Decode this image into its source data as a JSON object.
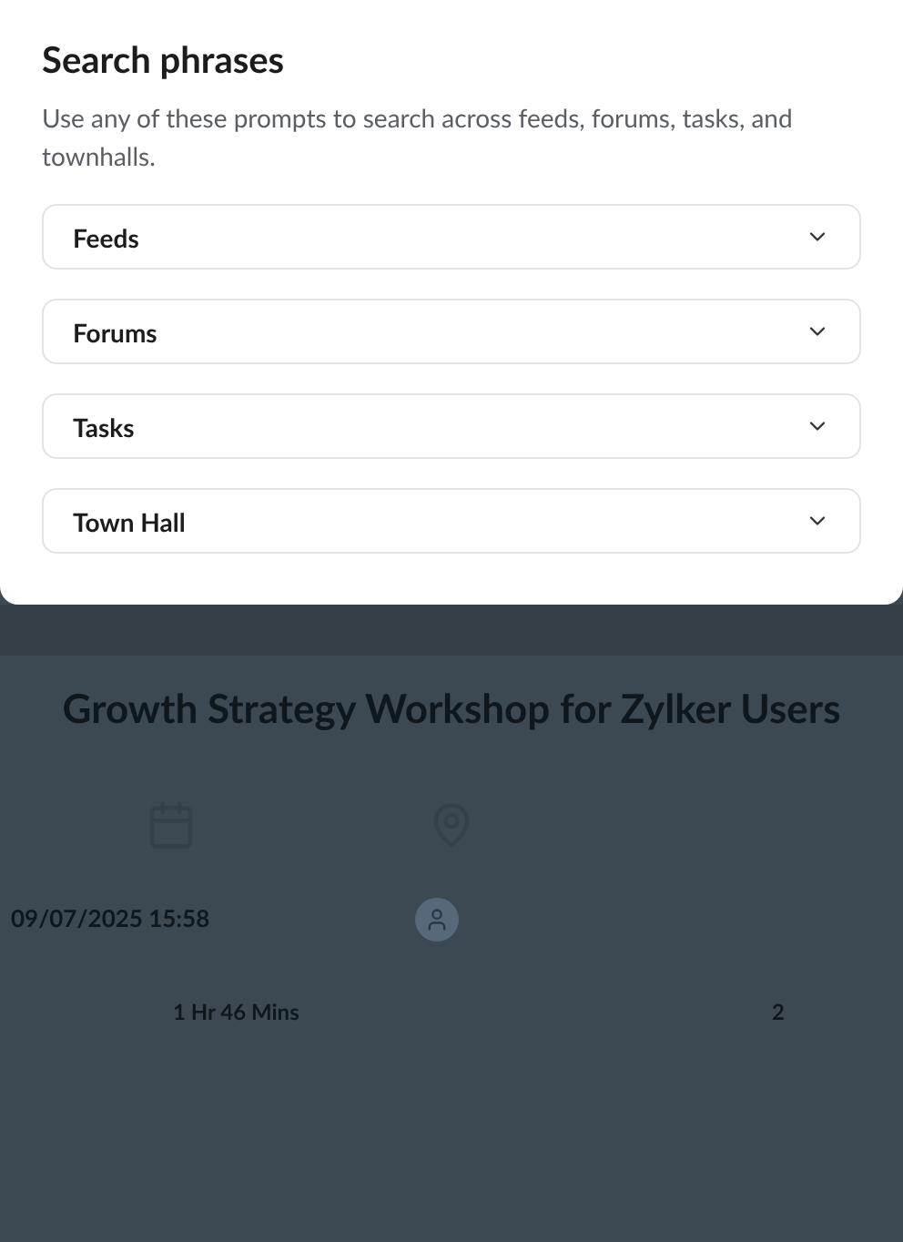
{
  "panel": {
    "title": "Search phrases",
    "description": "Use any of these prompts to search across feeds, forums, tasks, and townhalls.",
    "sections": [
      {
        "label": "Feeds",
        "expanded": false
      },
      {
        "label": "Forums",
        "expanded": false
      },
      {
        "label": "Tasks",
        "expanded": false
      },
      {
        "label": "Town Hall",
        "expanded": false
      }
    ]
  },
  "background": {
    "event_title": "Growth Strategy Workshop for Zylker Users",
    "date_time": "09/07/2025 15:58",
    "duration": "1 Hr 46 Mins",
    "attendee_count": "2"
  }
}
